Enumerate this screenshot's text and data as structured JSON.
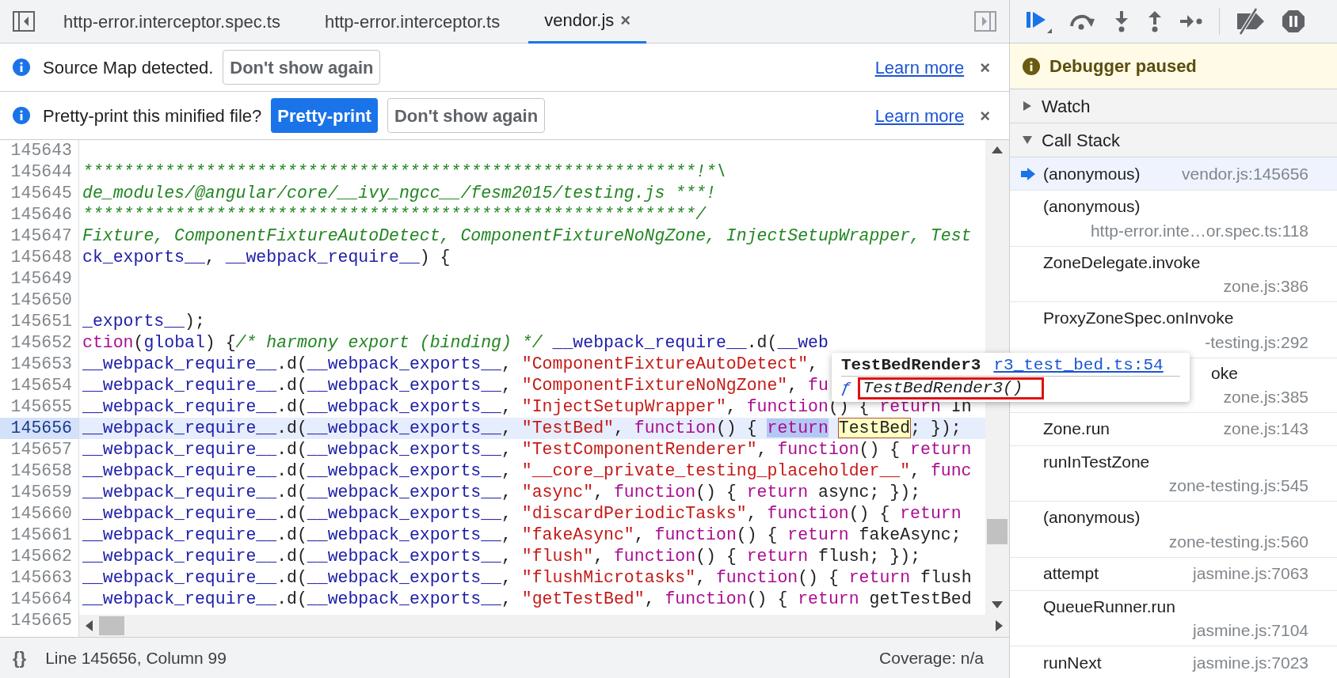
{
  "editor_tabs": [
    {
      "label": "http-error.interceptor.spec.ts",
      "selected": false,
      "closable": false
    },
    {
      "label": "http-error.interceptor.ts",
      "selected": false,
      "closable": false
    },
    {
      "label": "vendor.js",
      "selected": true,
      "closable": true,
      "close": "×"
    }
  ],
  "infobars": [
    {
      "message": "Source Map detected.",
      "buttons": [
        {
          "label": "Don't show again",
          "primary": false
        }
      ],
      "link": "Learn more",
      "close": "×"
    },
    {
      "message": "Pretty-print this minified file?",
      "buttons": [
        {
          "label": "Pretty-print",
          "primary": true
        },
        {
          "label": "Don't show again",
          "primary": false
        }
      ],
      "link": "Learn more",
      "close": "×"
    }
  ],
  "code": {
    "lines": [
      {
        "number": "145643",
        "current": false
      },
      {
        "number": "145644",
        "current": false,
        "tokens": [
          {
            "kind": "comment",
            "text": "************************************************************!*\\"
          }
        ]
      },
      {
        "number": "145645",
        "current": false,
        "tokens": [
          {
            "kind": "comment",
            "text": "de_modules/@angular/core/__ivy_ngcc__/fesm2015/testing.js ***!"
          }
        ]
      },
      {
        "number": "145646",
        "current": false,
        "tokens": [
          {
            "kind": "comment",
            "text": "************************************************************/"
          }
        ]
      },
      {
        "number": "145647",
        "current": false,
        "tokens": [
          {
            "kind": "comment",
            "text": "Fixture, ComponentFixtureAutoDetect, ComponentFixtureNoNgZone, InjectSetupWrapper, Test"
          }
        ]
      },
      {
        "number": "145648",
        "current": false,
        "tokens": [
          {
            "kind": "ident",
            "text": "ck_exports__"
          },
          {
            "kind": "punct",
            "text": ", "
          },
          {
            "kind": "ident",
            "text": "__webpack_require__"
          },
          {
            "kind": "punct",
            "text": ") {"
          }
        ]
      },
      {
        "number": "145649",
        "current": false
      },
      {
        "number": "145650",
        "current": false
      },
      {
        "number": "145651",
        "current": false,
        "tokens": [
          {
            "kind": "ident",
            "text": "_exports__"
          },
          {
            "kind": "punct",
            "text": ");"
          }
        ]
      },
      {
        "number": "145652",
        "current": false,
        "tokens": [
          {
            "kind": "keyword",
            "text": "ction"
          },
          {
            "kind": "punct",
            "text": "("
          },
          {
            "kind": "ident",
            "text": "global"
          },
          {
            "kind": "punct",
            "text": ") {"
          },
          {
            "kind": "comment",
            "text": "/* harmony export (binding) */"
          },
          {
            "kind": "ident",
            "text": " __webpack_require__"
          },
          {
            "kind": "punct",
            "text": ".d("
          },
          {
            "kind": "ident",
            "text": "__web"
          }
        ]
      },
      {
        "number": "145653",
        "current": false,
        "tokens": [
          {
            "kind": "ident",
            "text": "__webpack_require__"
          },
          {
            "kind": "punct",
            "text": ".d("
          },
          {
            "kind": "ident",
            "text": "__webpack_exports__"
          },
          {
            "kind": "punct",
            "text": ", "
          },
          {
            "kind": "string",
            "text": "\"ComponentFixtureAutoDetect\""
          },
          {
            "kind": "punct",
            "text": ","
          }
        ]
      },
      {
        "number": "145654",
        "current": false,
        "tokens": [
          {
            "kind": "ident",
            "text": "__webpack_require__"
          },
          {
            "kind": "punct",
            "text": ".d("
          },
          {
            "kind": "ident",
            "text": "__webpack_exports__"
          },
          {
            "kind": "punct",
            "text": ", "
          },
          {
            "kind": "string",
            "text": "\"ComponentFixtureNoNgZone\""
          },
          {
            "kind": "punct",
            "text": ", "
          },
          {
            "kind": "keyword",
            "text": "fu"
          }
        ]
      },
      {
        "number": "145655",
        "current": false,
        "tokens": [
          {
            "kind": "ident",
            "text": "__webpack_require__"
          },
          {
            "kind": "punct",
            "text": ".d("
          },
          {
            "kind": "ident",
            "text": "__webpack_exports__"
          },
          {
            "kind": "punct",
            "text": ", "
          },
          {
            "kind": "string",
            "text": "\"InjectSetupWrapper\""
          },
          {
            "kind": "punct",
            "text": ", "
          },
          {
            "kind": "keyword",
            "text": "function"
          },
          {
            "kind": "punct",
            "text": "() { "
          },
          {
            "kind": "keyword",
            "text": "return"
          },
          {
            "kind": "punct",
            "text": " In"
          }
        ]
      },
      {
        "number": "145656",
        "current": true,
        "tokens": [
          {
            "kind": "ident",
            "text": "__webpack_require__"
          },
          {
            "kind": "punct",
            "text": ".d("
          },
          {
            "kind": "ident",
            "text": "__webpack_exports__"
          },
          {
            "kind": "punct",
            "text": ", "
          },
          {
            "kind": "string",
            "text": "\"TestBed\""
          },
          {
            "kind": "punct",
            "text": ", "
          },
          {
            "kind": "keyword",
            "text": "function"
          },
          {
            "kind": "punct",
            "text": "() { "
          },
          {
            "kind": "keyword",
            "text": "return",
            "selected": true
          },
          {
            "kind": "punct",
            "text": "TestBed",
            "hovered": true,
            "spaced": true
          },
          {
            "kind": "punct",
            "text": "; });"
          }
        ]
      },
      {
        "number": "145657",
        "current": false,
        "tokens": [
          {
            "kind": "ident",
            "text": "__webpack_require__"
          },
          {
            "kind": "punct",
            "text": ".d("
          },
          {
            "kind": "ident",
            "text": "__webpack_exports__"
          },
          {
            "kind": "punct",
            "text": ", "
          },
          {
            "kind": "string",
            "text": "\"TestComponentRenderer\""
          },
          {
            "kind": "punct",
            "text": ", "
          },
          {
            "kind": "keyword",
            "text": "function"
          },
          {
            "kind": "punct",
            "text": "() { "
          },
          {
            "kind": "keyword",
            "text": "return"
          }
        ]
      },
      {
        "number": "145658",
        "current": false,
        "tokens": [
          {
            "kind": "ident",
            "text": "__webpack_require__"
          },
          {
            "kind": "punct",
            "text": ".d("
          },
          {
            "kind": "ident",
            "text": "__webpack_exports__"
          },
          {
            "kind": "punct",
            "text": ", "
          },
          {
            "kind": "string",
            "text": "\"__core_private_testing_placeholder__\""
          },
          {
            "kind": "punct",
            "text": ", "
          },
          {
            "kind": "keyword",
            "text": "func"
          }
        ]
      },
      {
        "number": "145659",
        "current": false,
        "tokens": [
          {
            "kind": "ident",
            "text": "__webpack_require__"
          },
          {
            "kind": "punct",
            "text": ".d("
          },
          {
            "kind": "ident",
            "text": "__webpack_exports__"
          },
          {
            "kind": "punct",
            "text": ", "
          },
          {
            "kind": "string",
            "text": "\"async\""
          },
          {
            "kind": "punct",
            "text": ", "
          },
          {
            "kind": "keyword",
            "text": "function"
          },
          {
            "kind": "punct",
            "text": "() { "
          },
          {
            "kind": "keyword",
            "text": "return"
          },
          {
            "kind": "punct",
            "text": " async; });"
          }
        ]
      },
      {
        "number": "145660",
        "current": false,
        "tokens": [
          {
            "kind": "ident",
            "text": "__webpack_require__"
          },
          {
            "kind": "punct",
            "text": ".d("
          },
          {
            "kind": "ident",
            "text": "__webpack_exports__"
          },
          {
            "kind": "punct",
            "text": ", "
          },
          {
            "kind": "string",
            "text": "\"discardPeriodicTasks\""
          },
          {
            "kind": "punct",
            "text": ", "
          },
          {
            "kind": "keyword",
            "text": "function"
          },
          {
            "kind": "punct",
            "text": "() { "
          },
          {
            "kind": "keyword",
            "text": "return"
          }
        ]
      },
      {
        "number": "145661",
        "current": false,
        "tokens": [
          {
            "kind": "ident",
            "text": "__webpack_require__"
          },
          {
            "kind": "punct",
            "text": ".d("
          },
          {
            "kind": "ident",
            "text": "__webpack_exports__"
          },
          {
            "kind": "punct",
            "text": ", "
          },
          {
            "kind": "string",
            "text": "\"fakeAsync\""
          },
          {
            "kind": "punct",
            "text": ", "
          },
          {
            "kind": "keyword",
            "text": "function"
          },
          {
            "kind": "punct",
            "text": "() { "
          },
          {
            "kind": "keyword",
            "text": "return"
          },
          {
            "kind": "punct",
            "text": " fakeAsync;"
          }
        ]
      },
      {
        "number": "145662",
        "current": false,
        "tokens": [
          {
            "kind": "ident",
            "text": "__webpack_require__"
          },
          {
            "kind": "punct",
            "text": ".d("
          },
          {
            "kind": "ident",
            "text": "__webpack_exports__"
          },
          {
            "kind": "punct",
            "text": ", "
          },
          {
            "kind": "string",
            "text": "\"flush\""
          },
          {
            "kind": "punct",
            "text": ", "
          },
          {
            "kind": "keyword",
            "text": "function"
          },
          {
            "kind": "punct",
            "text": "() { "
          },
          {
            "kind": "keyword",
            "text": "return"
          },
          {
            "kind": "punct",
            "text": " flush; });"
          }
        ]
      },
      {
        "number": "145663",
        "current": false,
        "tokens": [
          {
            "kind": "ident",
            "text": "__webpack_require__"
          },
          {
            "kind": "punct",
            "text": ".d("
          },
          {
            "kind": "ident",
            "text": "__webpack_exports__"
          },
          {
            "kind": "punct",
            "text": ", "
          },
          {
            "kind": "string",
            "text": "\"flushMicrotasks\""
          },
          {
            "kind": "punct",
            "text": ", "
          },
          {
            "kind": "keyword",
            "text": "function"
          },
          {
            "kind": "punct",
            "text": "() { "
          },
          {
            "kind": "keyword",
            "text": "return"
          },
          {
            "kind": "punct",
            "text": " flush"
          }
        ]
      },
      {
        "number": "145664",
        "current": false,
        "tokens": [
          {
            "kind": "ident",
            "text": "__webpack_require__"
          },
          {
            "kind": "punct",
            "text": ".d("
          },
          {
            "kind": "ident",
            "text": "__webpack_exports__"
          },
          {
            "kind": "punct",
            "text": ", "
          },
          {
            "kind": "string",
            "text": "\"getTestBed\""
          },
          {
            "kind": "punct",
            "text": ", "
          },
          {
            "kind": "keyword",
            "text": "function"
          },
          {
            "kind": "punct",
            "text": "() { "
          },
          {
            "kind": "keyword",
            "text": "return"
          },
          {
            "kind": "punct",
            "text": " getTestBed"
          }
        ]
      },
      {
        "number": "145665",
        "current": false
      }
    ],
    "tooltip": {
      "title": "TestBedRender3",
      "link": "r3_test_bed.ts:54",
      "function_mark": "ƒ",
      "signature": "TestBedRender3()"
    }
  },
  "status_bar": {
    "format_button": "{}",
    "position": "Line 145656, Column 99",
    "coverage": "Coverage: n/a"
  },
  "debugger": {
    "status": "Debugger paused",
    "sections": [
      {
        "title": "Watch",
        "expanded": false
      },
      {
        "title": "Call Stack",
        "expanded": true
      }
    ],
    "call_stack": [
      {
        "name": "(anonymous)",
        "location": "vendor.js:145656",
        "kind": "one-line",
        "selected": true
      },
      {
        "name": "(anonymous)",
        "location": "http-error.inte…or.spec.ts:118",
        "kind": "two-line",
        "selected": false
      },
      {
        "name": "ZoneDelegate.invoke",
        "location": "zone.js:386",
        "kind": "two-line",
        "selected": false
      },
      {
        "name": "ProxyZoneSpec.onInvoke",
        "location": "-testing.js:292",
        "kind": "two-line",
        "selected": false
      },
      {
        "name": "oke",
        "location": "zone.js:385",
        "kind": "partly-hidden",
        "selected": false
      },
      {
        "name": "Zone.run",
        "location": "zone.js:143",
        "kind": "one-line",
        "selected": false
      },
      {
        "name": "runInTestZone",
        "location": "zone-testing.js:545",
        "kind": "two-line",
        "selected": false
      },
      {
        "name": "(anonymous)",
        "location": "zone-testing.js:560",
        "kind": "two-line",
        "selected": false
      },
      {
        "name": "attempt",
        "location": "jasmine.js:7063",
        "kind": "one-line",
        "selected": false
      },
      {
        "name": "QueueRunner.run",
        "location": "jasmine.js:7104",
        "kind": "two-line",
        "selected": false
      },
      {
        "name": "runNext",
        "location": "jasmine.js:7023",
        "kind": "one-line",
        "selected": false
      }
    ]
  }
}
